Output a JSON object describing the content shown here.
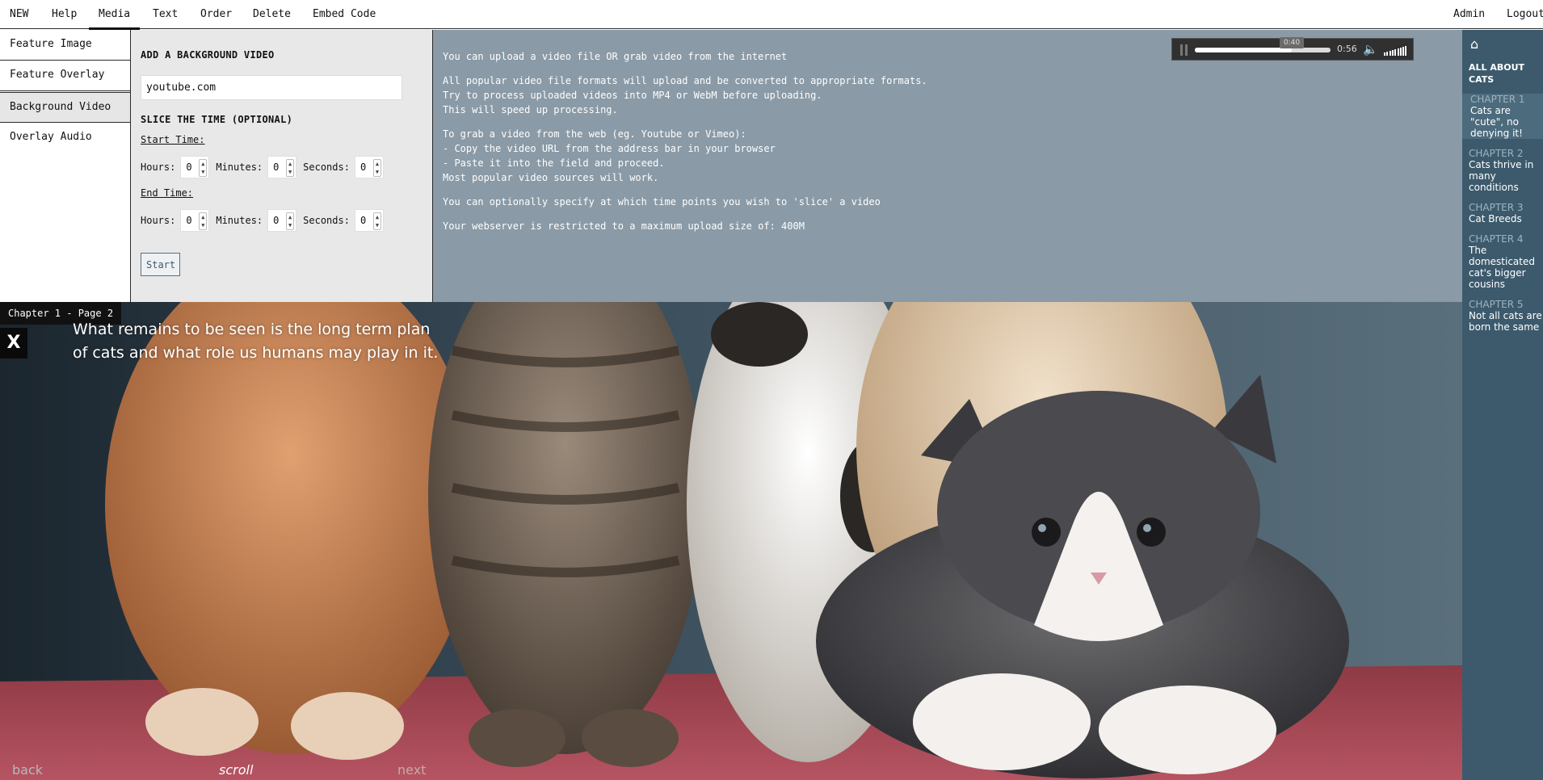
{
  "topbar": {
    "menu": [
      "NEW",
      "Help",
      "Media",
      "Text",
      "Order",
      "Delete",
      "Embed Code"
    ],
    "active": "Media",
    "admin": "Admin",
    "logout": "Logout"
  },
  "submenu": {
    "items": [
      "Feature Image",
      "Feature Overlay",
      "Background Video",
      "Overlay Audio"
    ],
    "active": "Background Video"
  },
  "form": {
    "heading": "ADD A BACKGROUND VIDEO",
    "url_value": "youtube.com",
    "slice_heading": "SLICE THE TIME (OPTIONAL)",
    "start_label": "Start Time:",
    "end_label": "End Time:",
    "hours_label": "Hours:",
    "minutes_label": "Minutes:",
    "seconds_label": "Seconds:",
    "start": {
      "hours": "0",
      "minutes": "0",
      "seconds": "0"
    },
    "end": {
      "hours": "0",
      "minutes": "0",
      "seconds": "0"
    },
    "button": "Start"
  },
  "info": {
    "paragraphs": [
      "You can upload a video file OR grab video from the internet",
      "All popular video file formats will upload and be converted to appropriate formats.\nTry to process uploaded videos into MP4 or WebM before uploading.\nThis will speed up processing.",
      "To grab a video from the web (eg. Youtube or Vimeo):\n- Copy the video URL from the address bar in your browser\n- Paste it into the field and proceed.\nMost popular video sources will work.",
      "You can optionally specify at which time points you wish to 'slice' a video",
      "Your webserver is restricted to a maximum upload size of: 400M"
    ]
  },
  "player": {
    "current_time": "0:40",
    "duration": "0:56",
    "progress": 0.714,
    "volume": 1.0
  },
  "sidebar": {
    "home_icon": "home-icon",
    "book_title": "ALL ABOUT CATS",
    "chapters": [
      {
        "num": "CHAPTER 1",
        "title": "Cats are \"cute\", no denying it!"
      },
      {
        "num": "CHAPTER 2",
        "title": "Cats thrive in many conditions"
      },
      {
        "num": "CHAPTER 3",
        "title": "Cat Breeds"
      },
      {
        "num": "CHAPTER 4",
        "title": "The domesticated cat's bigger cousins"
      },
      {
        "num": "CHAPTER 5",
        "title": "Not all cats are born the same"
      }
    ]
  },
  "stage": {
    "page_label": "Chapter 1 - Page 2",
    "close": "X",
    "text": "What remains to be seen is the long term plan of cats and what role us humans may play in it.",
    "back": "back",
    "scroll": "scroll",
    "next": "next"
  },
  "colors": {
    "info_bg": "#8a9aa6",
    "sidebar_bg": "#3c5a6c",
    "form_bg": "#e8e8e8"
  }
}
